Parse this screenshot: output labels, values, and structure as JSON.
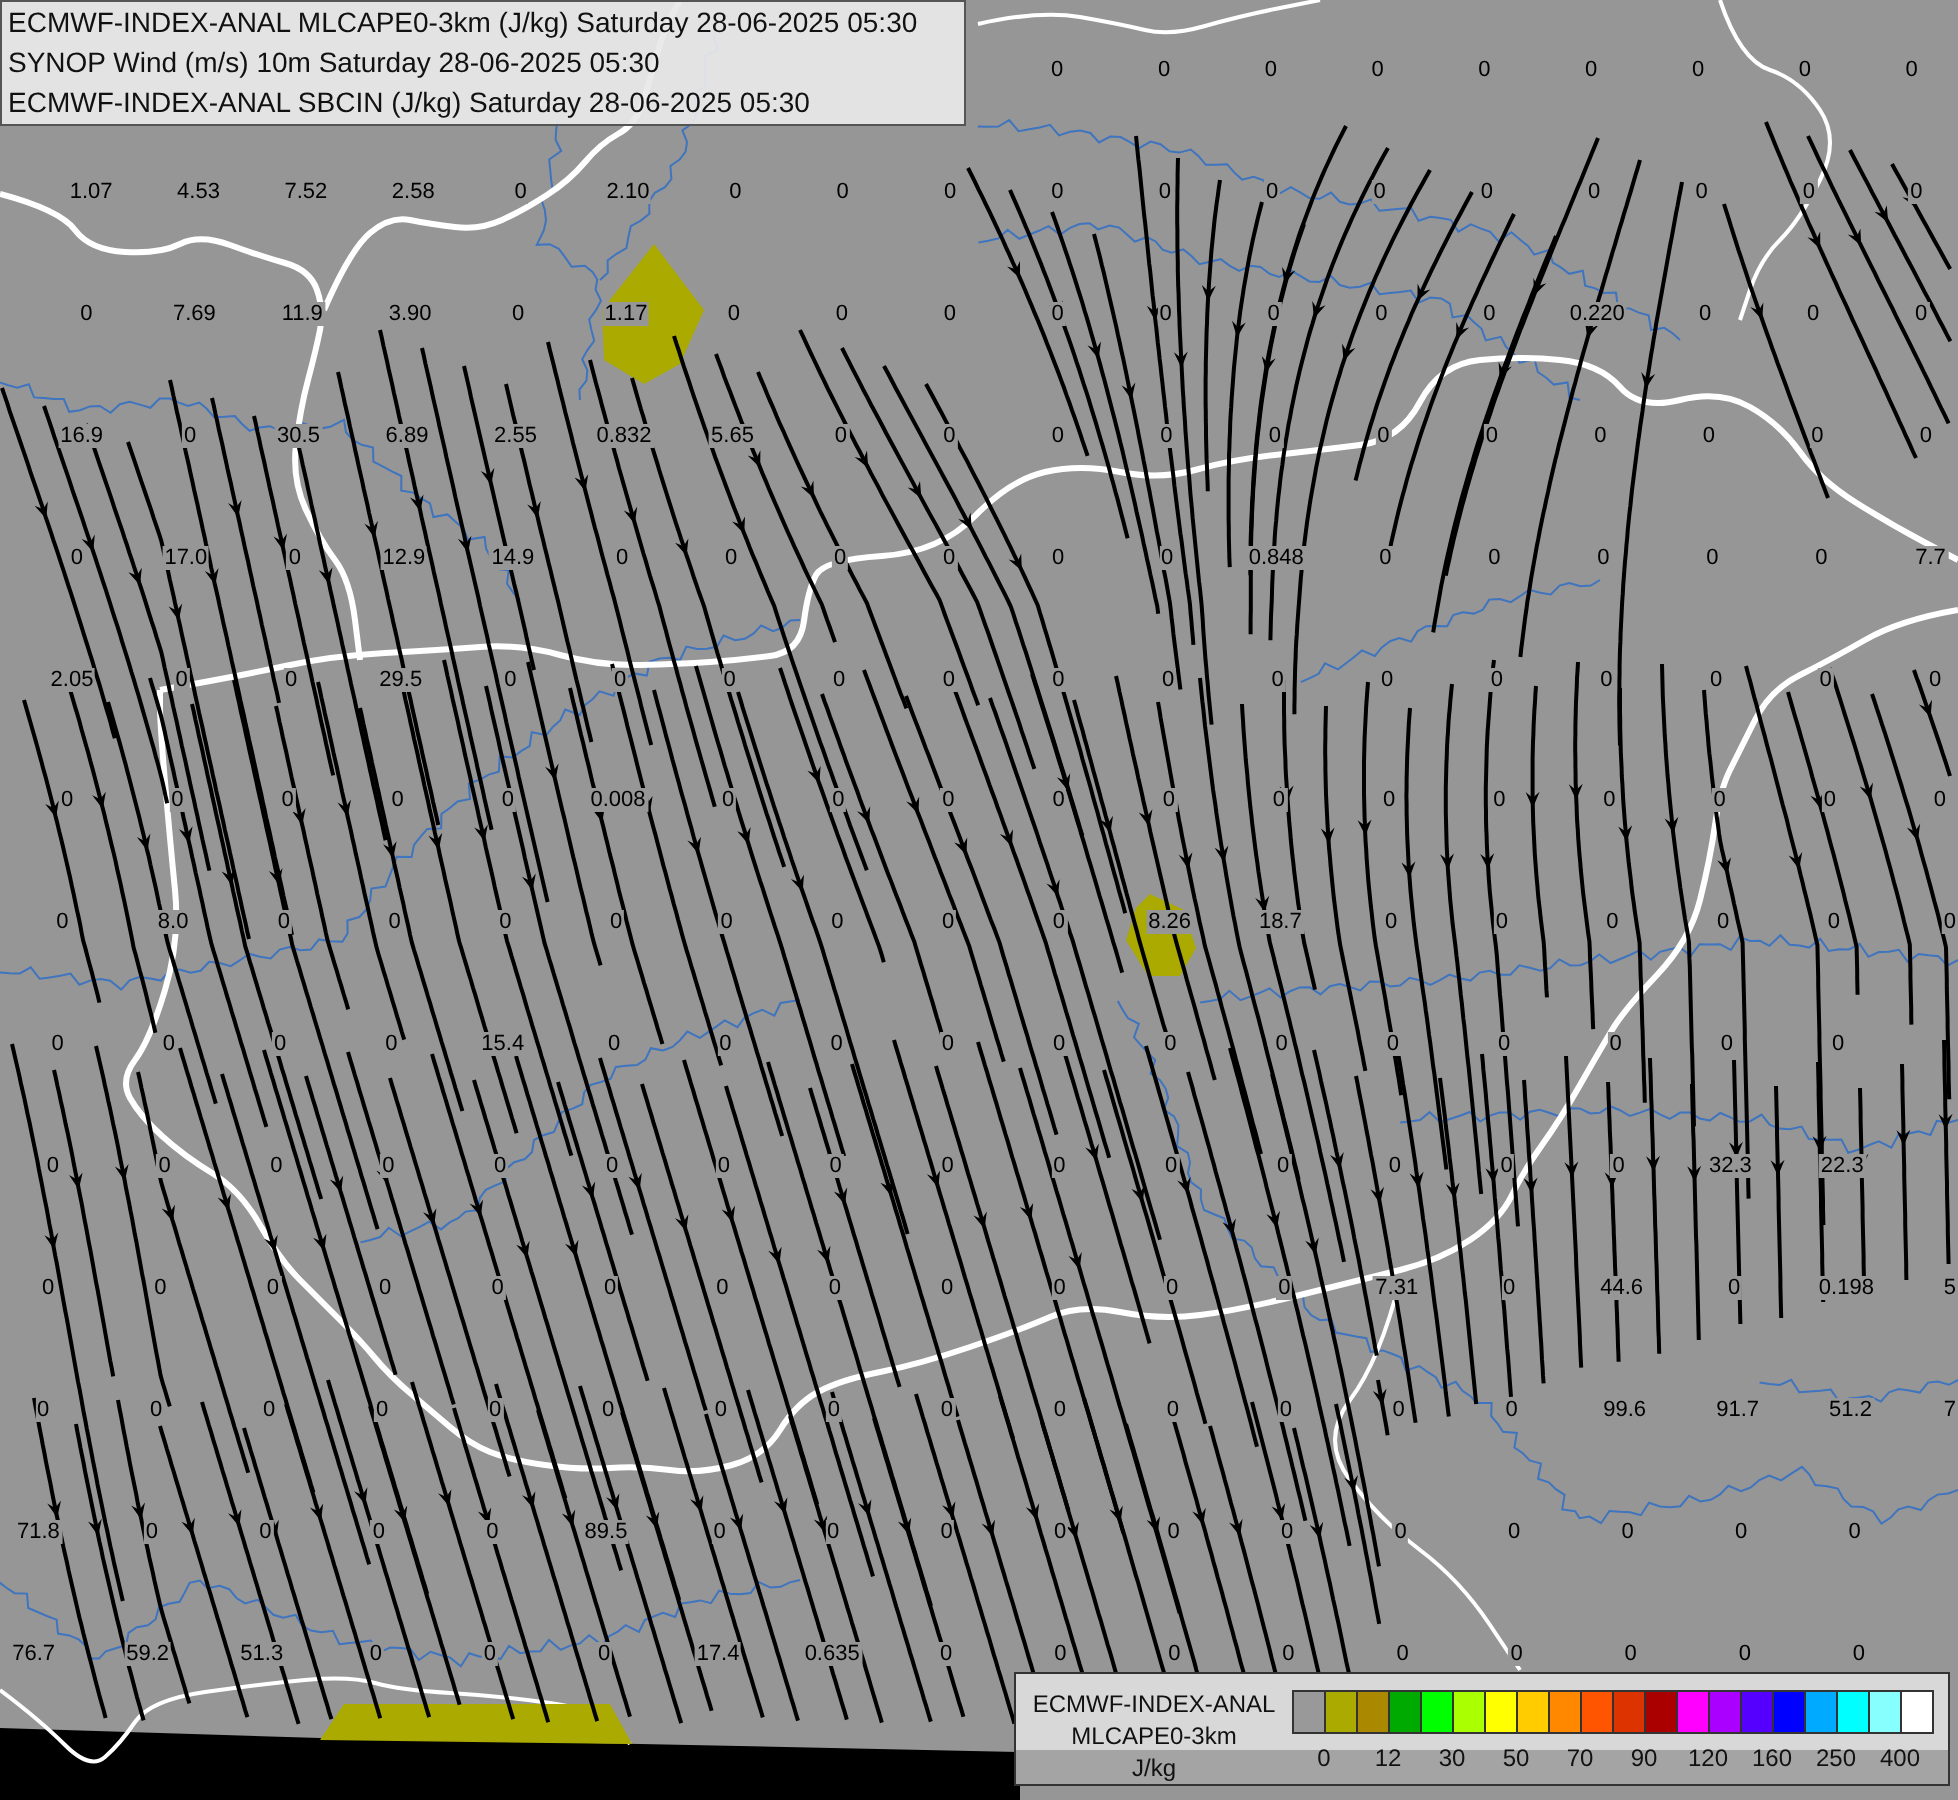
{
  "header": {
    "lines": [
      "ECMWF-INDEX-ANAL MLCAPE0-3km (J/kg) Saturday 28-06-2025 05:30",
      "SYNOP Wind (m/s) 10m Saturday 28-06-2025 05:30",
      "ECMWF-INDEX-ANAL SBCIN (J/kg) Saturday 28-06-2025 05:30"
    ]
  },
  "map": {
    "top_row_values": [
      "0",
      "0",
      "0",
      "0",
      "0",
      "0",
      "0",
      "0",
      "0"
    ],
    "value_grid": [
      [
        "1.07",
        "4.53",
        "7.52",
        "2.58",
        "0",
        "2.10",
        "0",
        "0",
        "0",
        "0",
        "0",
        "0",
        "0",
        "0",
        "0",
        "0",
        "0",
        "0"
      ],
      [
        "0",
        "7.69",
        "11.9",
        "3.90",
        "0",
        "1.17",
        "0",
        "0",
        "0",
        "0",
        "0",
        "0",
        "0",
        "0",
        "0.220",
        "0",
        "0",
        "0"
      ],
      [
        "16.9",
        "0",
        "30.5",
        "6.89",
        "2.55",
        "0.832",
        "5.65",
        "0",
        "0",
        "0",
        "0",
        "0",
        "0",
        "0",
        "0",
        "0",
        "0",
        "0"
      ],
      [
        "0",
        "17.0",
        "0",
        "12.9",
        "14.9",
        "0",
        "0",
        "0",
        "0",
        "0",
        "0",
        "0.848",
        "0",
        "0",
        "0",
        "0",
        "0",
        "7.7"
      ],
      [
        "2.05",
        "0",
        "0",
        "29.5",
        "0",
        "0",
        "0",
        "0",
        "0",
        "0",
        "0",
        "0",
        "0",
        "0",
        "0",
        "0",
        "0",
        "0"
      ],
      [
        "0",
        "0",
        "0",
        "0",
        "0",
        "0.008",
        "0",
        "0",
        "0",
        "0",
        "0",
        "0",
        "0",
        "0",
        "0",
        "0",
        "0",
        "0"
      ],
      [
        "0",
        "8.0",
        "0",
        "0",
        "0",
        "0",
        "0",
        "0",
        "0",
        "0",
        "8.26",
        "18.7",
        "0",
        "0",
        "0",
        "0",
        "0",
        "0"
      ],
      [
        "0",
        "0",
        "0",
        "0",
        "15.4",
        "0",
        "0",
        "0",
        "0",
        "0",
        "0",
        "0",
        "0",
        "0",
        "0",
        "0",
        "0"
      ],
      [
        "0",
        "0",
        "0",
        "0",
        "0",
        "0",
        "0",
        "0",
        "0",
        "0",
        "0",
        "0",
        "0",
        "0",
        "0",
        "32.3",
        "22.3"
      ],
      [
        "0",
        "0",
        "0",
        "0",
        "0",
        "0",
        "0",
        "0",
        "0",
        "0",
        "0",
        "0",
        "7.31",
        "0",
        "44.6",
        "0",
        "0.198",
        "5"
      ],
      [
        "0",
        "0",
        "0",
        "0",
        "0",
        "0",
        "0",
        "0",
        "0",
        "0",
        "0",
        "0",
        "0",
        "0",
        "99.6",
        "91.7",
        "51.2",
        "7"
      ],
      [
        "71.8",
        "0",
        "0",
        "0",
        "0",
        "89.5",
        "0",
        "0",
        "0",
        "0",
        "0",
        "0",
        "0",
        "0",
        "0",
        "0",
        "0"
      ],
      [
        "76.7",
        "59.2",
        "51.3",
        "0",
        "0",
        "0",
        "17.4",
        "0.635",
        "0",
        "0",
        "0",
        "0",
        "0",
        "0",
        "0",
        "0",
        "0"
      ]
    ]
  },
  "legend": {
    "title": [
      "ECMWF-INDEX-ANAL",
      "MLCAPE0-3km"
    ],
    "unit": "J/kg",
    "swatches": [
      {
        "color": "#999999"
      },
      {
        "color": "#aaaa00"
      },
      {
        "color": "#aa8800"
      },
      {
        "color": "#00aa00"
      },
      {
        "color": "#00ff00"
      },
      {
        "color": "#aaff00"
      },
      {
        "color": "#ffff00"
      },
      {
        "color": "#ffcc00"
      },
      {
        "color": "#ff8800"
      },
      {
        "color": "#ff5500"
      },
      {
        "color": "#dd3300"
      },
      {
        "color": "#aa0000"
      },
      {
        "color": "#ff00ff"
      },
      {
        "color": "#aa00ff"
      },
      {
        "color": "#5500ff"
      },
      {
        "color": "#0000ff"
      },
      {
        "color": "#00aaff"
      },
      {
        "color": "#00ffff"
      },
      {
        "color": "#88ffff"
      },
      {
        "color": "#ffffff"
      }
    ],
    "ticks": [
      "0",
      "12",
      "30",
      "50",
      "70",
      "90",
      "120",
      "160",
      "250",
      "400"
    ]
  }
}
